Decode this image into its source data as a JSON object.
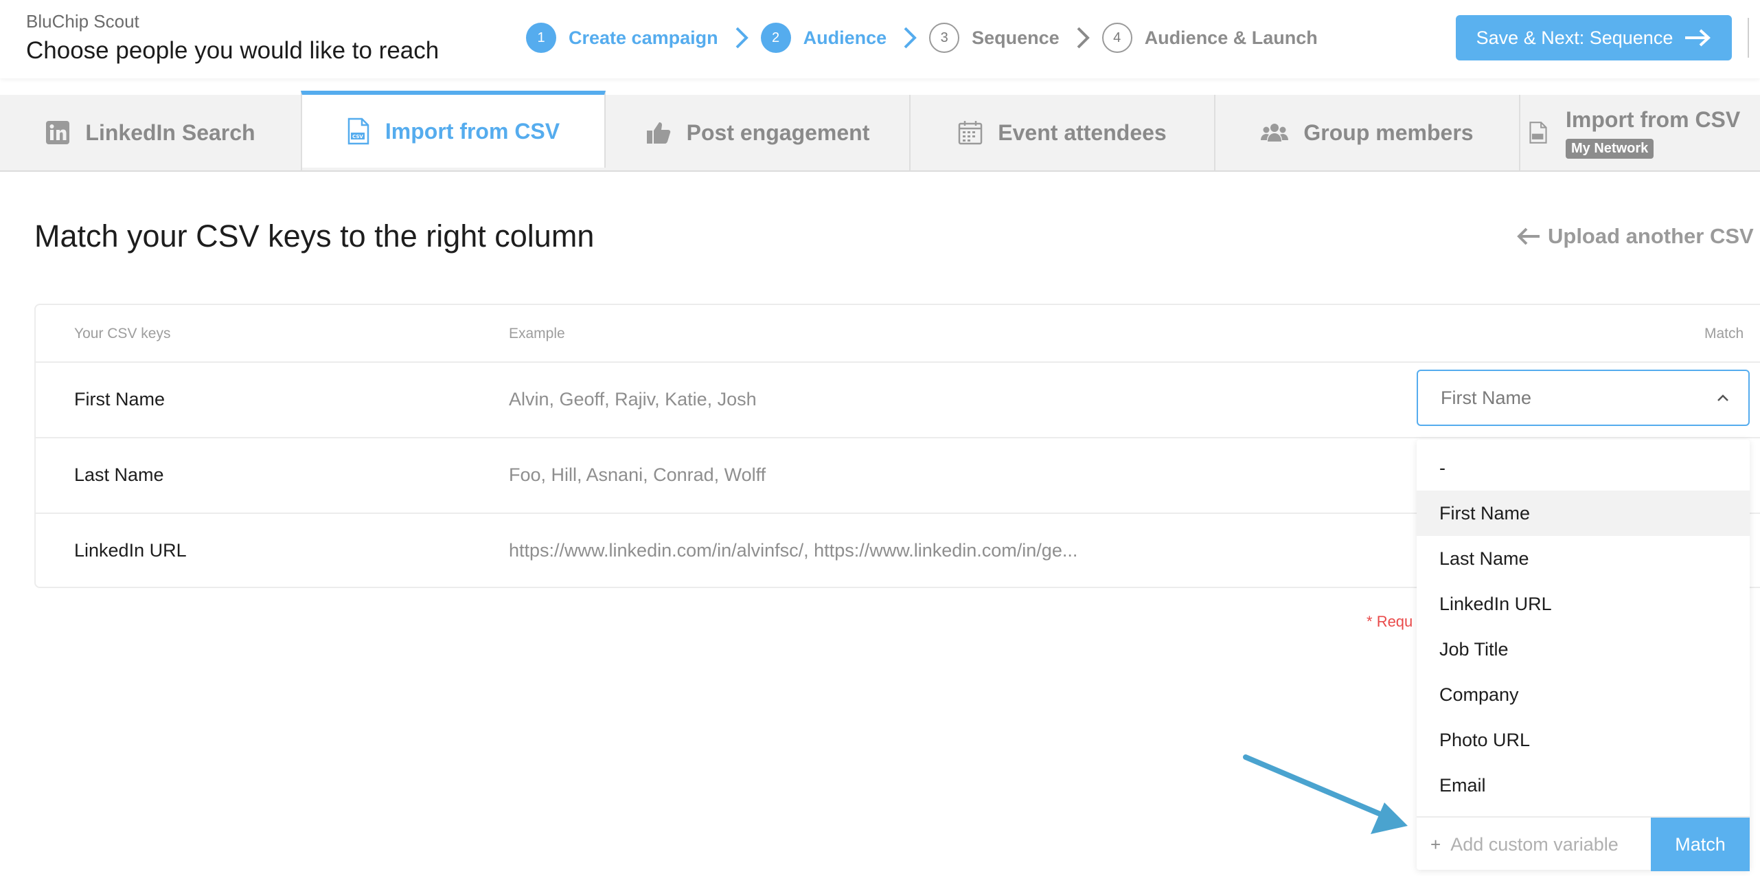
{
  "header": {
    "app_name": "BluChip Scout",
    "title": "Choose people you would like to reach",
    "steps": [
      {
        "num": "1",
        "label": "Create campaign",
        "state": "active"
      },
      {
        "num": "2",
        "label": "Audience",
        "state": "active"
      },
      {
        "num": "3",
        "label": "Sequence",
        "state": "inactive"
      },
      {
        "num": "4",
        "label": "Audience & Launch",
        "state": "inactive"
      }
    ],
    "save_next_label": "Save & Next: Sequence"
  },
  "tabs": [
    {
      "label": "LinkedIn Search",
      "icon": "linkedin-icon"
    },
    {
      "label": "Import from CSV",
      "icon": "csv-file-icon",
      "active": true
    },
    {
      "label": "Post engagement",
      "icon": "thumbs-up-icon"
    },
    {
      "label": "Event attendees",
      "icon": "calendar-icon"
    },
    {
      "label": "Group members",
      "icon": "users-icon"
    },
    {
      "label": "Import from CSV",
      "badge": "My Network",
      "icon": "csv-file-icon"
    }
  ],
  "main": {
    "section_title": "Match your CSV keys to the right column",
    "upload_link": "Upload another CSV",
    "table": {
      "headers": {
        "keys": "Your CSV keys",
        "example": "Example",
        "match": "Match"
      },
      "rows": [
        {
          "key": "First Name",
          "example": "Alvin, Geoff, Rajiv, Katie, Josh"
        },
        {
          "key": "Last Name",
          "example": "Foo, Hill, Asnani, Conrad, Wolff"
        },
        {
          "key": "LinkedIn URL",
          "example": "https://www.linkedin.com/in/alvinfsc/, https://www.linkedin.com/in/ge..."
        }
      ]
    },
    "required_text": "Requ"
  },
  "dropdown": {
    "selected": "First Name",
    "options": [
      "-",
      "First Name",
      "Last Name",
      "LinkedIn URL",
      "Job Title",
      "Company",
      "Photo URL",
      "Email"
    ],
    "custom_placeholder": "Add custom variable",
    "match_label": "Match"
  },
  "colors": {
    "accent": "#55acee",
    "annotation_arrow": "#4aa3cf",
    "required": "#e94a4a"
  }
}
